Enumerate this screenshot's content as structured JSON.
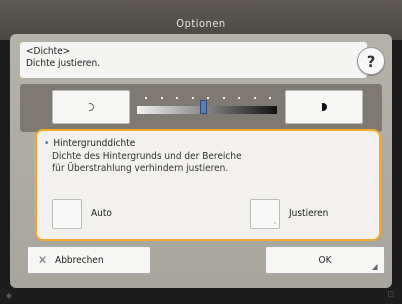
{
  "window": {
    "title": "Optionen"
  },
  "header": {
    "line1": "<Dichte>",
    "line2": "Dichte justieren.",
    "help_label": "?"
  },
  "density": {
    "level": 0.45
  },
  "group": {
    "title": "Hintergrunddichte",
    "desc_line1": "Dichte des Hintergrunds und der Bereiche",
    "desc_line2": "für Überstrahlung verhindern justieren.",
    "auto_label": "Auto",
    "adjust_label": "Justieren"
  },
  "footer_buttons": {
    "cancel_label": "Abbrechen",
    "ok_label": "OK"
  },
  "icons": {
    "help": "question-icon",
    "cancel": "x-icon",
    "decrease": "light-density-icon",
    "increase": "dark-density-icon"
  }
}
